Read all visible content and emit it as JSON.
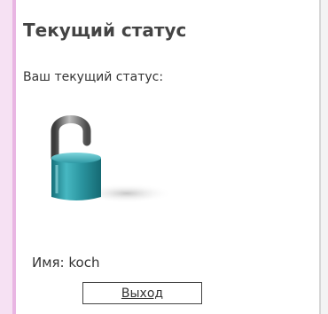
{
  "panel": {
    "title": "Текущий статус",
    "status_label": "Ваш текущий статус:",
    "status_icon": "unlocked-padlock-icon",
    "user_label": "Имя:",
    "user_name": "koch",
    "logout_label": "Выход"
  },
  "colors": {
    "left_stripe": "#f6e1f3",
    "left_stripe_edge": "#e9b6e3",
    "lock_body": "#2f9aa5",
    "lock_shackle": "#5a5a5a"
  }
}
